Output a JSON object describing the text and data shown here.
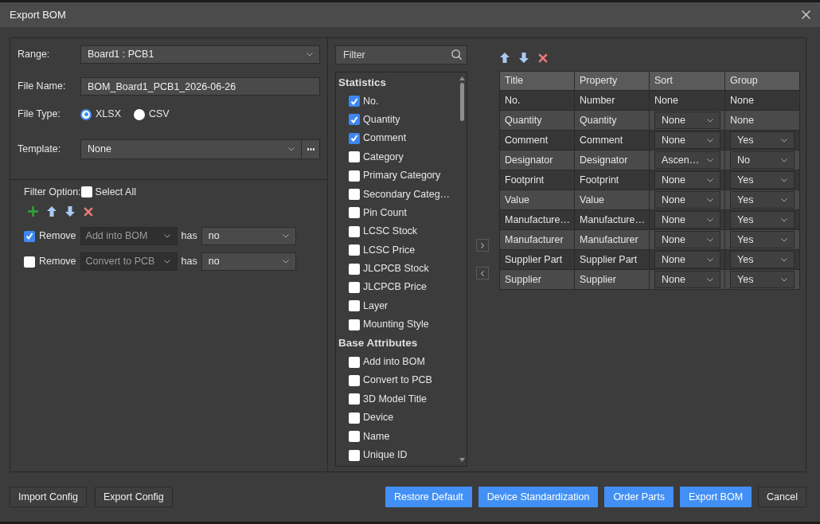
{
  "window": {
    "title": "Export BOM"
  },
  "settings": {
    "range": {
      "label": "Range:",
      "value": "Board1 : PCB1"
    },
    "file_name": {
      "label": "File Name:",
      "value": "BOM_Board1_PCB1_2026-06-26"
    },
    "file_type": {
      "label": "File Type:",
      "options": [
        {
          "label": "XLSX",
          "selected": true
        },
        {
          "label": "CSV",
          "selected": false
        }
      ]
    },
    "template": {
      "label": "Template:",
      "value": "None"
    }
  },
  "filter": {
    "label": "Filter Option:",
    "select_all": {
      "label": "Select All",
      "checked": false
    },
    "rules": [
      {
        "checked": true,
        "action": "Remove",
        "attribute": "Add into BOM",
        "operator": "has",
        "value": "no"
      },
      {
        "checked": false,
        "action": "Remove",
        "attribute": "Convert to PCB",
        "operator": "has",
        "value": "no"
      }
    ]
  },
  "column_list": {
    "search": {
      "placeholder": "Filter"
    },
    "groups": [
      {
        "title": "Statistics",
        "items": [
          {
            "label": "No.",
            "checked": true
          },
          {
            "label": "Quantity",
            "checked": true
          },
          {
            "label": "Comment",
            "checked": true
          },
          {
            "label": "Category",
            "checked": false
          },
          {
            "label": "Primary Category",
            "checked": false
          },
          {
            "label": "Secondary Categ…",
            "checked": false
          },
          {
            "label": "Pin Count",
            "checked": false
          },
          {
            "label": "LCSC Stock",
            "checked": false
          },
          {
            "label": "LCSC Price",
            "checked": false
          },
          {
            "label": "JLCPCB Stock",
            "checked": false
          },
          {
            "label": "JLCPCB Price",
            "checked": false
          },
          {
            "label": "Layer",
            "checked": false
          },
          {
            "label": "Mounting Style",
            "checked": false
          }
        ]
      },
      {
        "title": "Base Attributes",
        "items": [
          {
            "label": "Add into BOM",
            "checked": false
          },
          {
            "label": "Convert to PCB",
            "checked": false
          },
          {
            "label": "3D Model Title",
            "checked": false
          },
          {
            "label": "Device",
            "checked": false
          },
          {
            "label": "Name",
            "checked": false
          },
          {
            "label": "Unique ID",
            "checked": false
          }
        ]
      }
    ]
  },
  "table": {
    "columns": [
      "Title",
      "Property",
      "Sort",
      "Group"
    ],
    "rows": [
      {
        "title": "No.",
        "property": "Number",
        "sort": {
          "kind": "text",
          "value": "None"
        },
        "group": {
          "kind": "text",
          "value": "None"
        }
      },
      {
        "title": "Quantity",
        "property": "Quantity",
        "sort": {
          "kind": "select",
          "value": "None"
        },
        "group": {
          "kind": "text",
          "value": "None"
        }
      },
      {
        "title": "Comment",
        "property": "Comment",
        "sort": {
          "kind": "select",
          "value": "None"
        },
        "group": {
          "kind": "select",
          "value": "Yes"
        }
      },
      {
        "title": "Designator",
        "property": "Designator",
        "sort": {
          "kind": "select",
          "value": "Ascen…"
        },
        "group": {
          "kind": "select",
          "value": "No"
        }
      },
      {
        "title": "Footprint",
        "property": "Footprint",
        "sort": {
          "kind": "select",
          "value": "None"
        },
        "group": {
          "kind": "select",
          "value": "Yes"
        }
      },
      {
        "title": "Value",
        "property": "Value",
        "sort": {
          "kind": "select",
          "value": "None"
        },
        "group": {
          "kind": "select",
          "value": "Yes"
        }
      },
      {
        "title": "Manufacture…",
        "property": "Manufacture…",
        "sort": {
          "kind": "select",
          "value": "None"
        },
        "group": {
          "kind": "select",
          "value": "Yes"
        }
      },
      {
        "title": "Manufacturer",
        "property": "Manufacturer",
        "sort": {
          "kind": "select",
          "value": "None"
        },
        "group": {
          "kind": "select",
          "value": "Yes"
        }
      },
      {
        "title": "Supplier Part",
        "property": "Supplier Part",
        "sort": {
          "kind": "select",
          "value": "None"
        },
        "group": {
          "kind": "select",
          "value": "Yes"
        }
      },
      {
        "title": "Supplier",
        "property": "Supplier",
        "sort": {
          "kind": "select",
          "value": "None"
        },
        "group": {
          "kind": "select",
          "value": "Yes"
        }
      }
    ]
  },
  "footer": {
    "left_buttons": [
      "Import Config",
      "Export Config"
    ],
    "right_buttons": [
      {
        "label": "Restore Default",
        "kind": "primary"
      },
      {
        "label": "Device Standardization",
        "kind": "primary"
      },
      {
        "label": "Order Parts",
        "kind": "primary"
      },
      {
        "label": "Export BOM",
        "kind": "primary"
      },
      {
        "label": "Cancel",
        "kind": "secondary"
      }
    ]
  }
}
